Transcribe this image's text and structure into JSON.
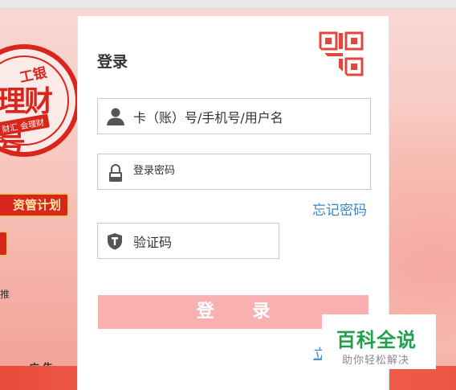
{
  "banner": {
    "seal_top": "工银",
    "seal_main": "理财号",
    "seal_ribbon": "财汇 会理财",
    "plan_tag": "资管计划",
    "small_text": "推",
    "ad_label": "广告"
  },
  "login": {
    "title": "登录",
    "username_placeholder": "卡（账）号/手机号/用户名",
    "password_placeholder": "登录密码",
    "forgot_link": "忘记密码",
    "captcha_placeholder": "验证码",
    "submit_label": "登 录",
    "register_link": "立"
  },
  "watermark": {
    "title": "百科全说",
    "subtitle": "助你轻松解决"
  },
  "colors": {
    "accent_red": "#d9261c",
    "button_pink": "#f8b0b0",
    "link_blue": "#3a86c8",
    "watermark_green": "#21a04a"
  },
  "icons": [
    "qr-code-icon",
    "user-icon",
    "lock-icon",
    "shield-icon",
    "chevron-right-icon"
  ]
}
